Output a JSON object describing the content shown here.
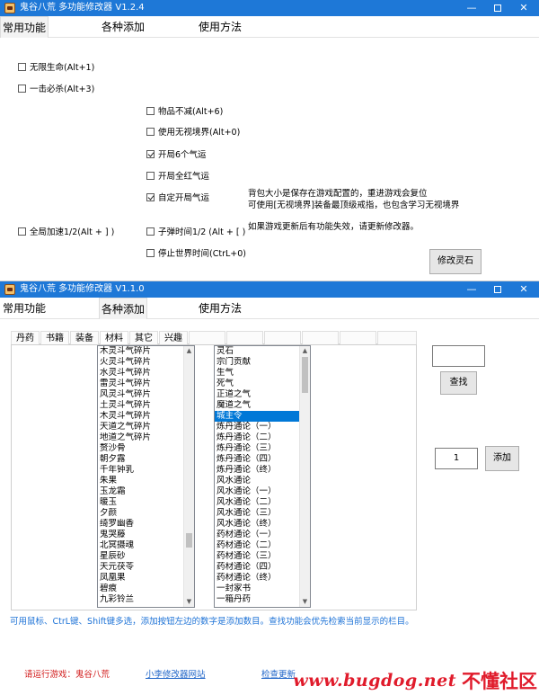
{
  "window1": {
    "title": "鬼谷八荒 多功能修改器  V1.2.4",
    "tabs": [
      {
        "label": "常用功能",
        "active": true
      },
      {
        "label": "各种添加",
        "active": false
      },
      {
        "label": "使用方法",
        "active": false
      }
    ],
    "checkboxes": [
      {
        "label": "无限生命(Alt+1)",
        "checked": false
      },
      {
        "label": "一击必杀(Alt+3)",
        "checked": false
      },
      {
        "label": "物品不减(Alt+6)",
        "checked": false
      },
      {
        "label": "使用无视境界(Alt+0)",
        "checked": false
      },
      {
        "label": "开局6个气运",
        "checked": true
      },
      {
        "label": "开局全红气运",
        "checked": false
      },
      {
        "label": "自定开局气运",
        "checked": true
      },
      {
        "label": "全局加速1/2(Alt + ] )",
        "checked": false
      },
      {
        "label": "子弹时间1/2 (Alt + [ )",
        "checked": false
      },
      {
        "label": "停止世界时间(CtrL+0)",
        "checked": false
      }
    ],
    "notes": [
      "背包大小是保存在游戏配置的，重进游戏会复位",
      "可使用[无视境界]装备最顶级戒指，也包含学习无视境界",
      "如果游戏更新后有功能失效，请更新修改器。"
    ],
    "modify_button": "修改灵石"
  },
  "window2": {
    "title": "鬼谷八荒 多功能修改器  V1.1.0",
    "tabs": [
      {
        "label": "常用功能",
        "active": false
      },
      {
        "label": "各种添加",
        "active": true
      },
      {
        "label": "使用方法",
        "active": false
      }
    ],
    "subtabs": [
      {
        "label": "丹药",
        "active": false
      },
      {
        "label": "书籍",
        "active": false
      },
      {
        "label": "装备",
        "active": false
      },
      {
        "label": "材料",
        "active": true
      },
      {
        "label": "其它",
        "active": false
      },
      {
        "label": "兴趣",
        "active": false
      }
    ],
    "materials": [
      "木灵斗气碎片",
      "火灵斗气碎片",
      "水灵斗气碎片",
      "雷灵斗气碎片",
      "风灵斗气碎片",
      "土灵斗气碎片",
      "木灵斗气碎片",
      "天道之气碎片",
      "地道之气碎片",
      "赘沙骨",
      "朝夕露",
      "千年钟乳",
      "朱果",
      "玉龙霜",
      "暖玉",
      "夕颜",
      "绮罗幽香",
      "鬼哭藤",
      "北冥摄魂",
      "星辰砂",
      "天元茯苓",
      "凤凰果",
      "碧痕",
      "九彩铃兰"
    ],
    "items": [
      "灵石",
      "宗门贡献",
      "生气",
      "死气",
      "正道之气",
      "魔道之气",
      "城主令",
      "炼丹通论（一）",
      "炼丹通论（二）",
      "炼丹通论（三）",
      "炼丹通论（四）",
      "炼丹通论（终）",
      "风水通论",
      "风水通论（一）",
      "风水通论（二）",
      "风水通论（三）",
      "风水通论（终）",
      "药材通论（一）",
      "药材通论（二）",
      "药材通论（三）",
      "药材通论（四）",
      "药材通论（终）",
      "一封家书",
      "一箱丹药"
    ],
    "selected_item": "城主令",
    "search_value": "",
    "search_button": "查找",
    "quantity_value": "1",
    "add_button": "添加",
    "hint": "可用鼠标、CtrL键、Shift键多选，添加按钮左边的数字是添加数目。查找功能会优先检索当前显示的栏目。",
    "footer": {
      "running": "请运行游戏：鬼谷八荒",
      "site_link": "小李修改器网站",
      "update_link": "检查更新"
    }
  },
  "watermark": {
    "site": "www.bugdog.net",
    "name": "不懂社区"
  }
}
